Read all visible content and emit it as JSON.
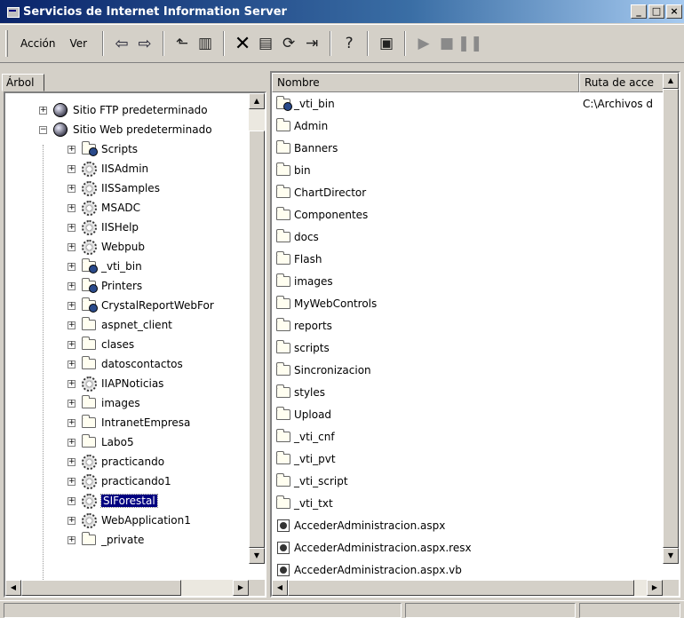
{
  "window": {
    "title": "Servicios de Internet Information Server",
    "controls": [
      "_",
      "□",
      "×"
    ]
  },
  "menu": {
    "action": "Acción",
    "view": "Ver"
  },
  "toolbar_icons": [
    "back-icon",
    "forward-icon",
    "up-folder-icon",
    "show-tree-icon",
    "delete-icon",
    "properties-icon",
    "refresh-icon",
    "export-icon",
    "help-icon",
    "computer-icon",
    "play-icon",
    "stop-icon",
    "pause-icon"
  ],
  "tree": {
    "tab_label": "Árbol",
    "items": [
      {
        "label": "Sitio FTP predeterminado",
        "icon": "ftp-site-icon",
        "expander": "+",
        "level": 0
      },
      {
        "label": "Sitio Web predeterminado",
        "icon": "web-site-icon",
        "expander": "−",
        "level": 0
      },
      {
        "label": "Scripts",
        "icon": "web-folder-icon",
        "expander": "+",
        "level": 1
      },
      {
        "label": "IISAdmin",
        "icon": "gear-icon",
        "expander": "+",
        "level": 1
      },
      {
        "label": "IISSamples",
        "icon": "gear-icon",
        "expander": "+",
        "level": 1
      },
      {
        "label": "MSADC",
        "icon": "gear-icon",
        "expander": "+",
        "level": 1
      },
      {
        "label": "IISHelp",
        "icon": "gear-icon",
        "expander": "+",
        "level": 1
      },
      {
        "label": "Webpub",
        "icon": "gear-icon",
        "expander": "+",
        "level": 1
      },
      {
        "label": "_vti_bin",
        "icon": "web-folder-icon",
        "expander": "+",
        "level": 1
      },
      {
        "label": "Printers",
        "icon": "web-folder-icon",
        "expander": "+",
        "level": 1
      },
      {
        "label": "CrystalReportWebFor",
        "icon": "web-folder-icon",
        "expander": "+",
        "level": 1
      },
      {
        "label": "aspnet_client",
        "icon": "folder-icon",
        "expander": "+",
        "level": 1
      },
      {
        "label": "clases",
        "icon": "folder-icon",
        "expander": "+",
        "level": 1
      },
      {
        "label": "datoscontactos",
        "icon": "folder-icon",
        "expander": "+",
        "level": 1
      },
      {
        "label": "IIAPNoticias",
        "icon": "gear-icon",
        "expander": "+",
        "level": 1
      },
      {
        "label": "images",
        "icon": "folder-icon",
        "expander": "+",
        "level": 1
      },
      {
        "label": "IntranetEmpresa",
        "icon": "folder-icon",
        "expander": "+",
        "level": 1
      },
      {
        "label": "Labo5",
        "icon": "folder-icon",
        "expander": "+",
        "level": 1
      },
      {
        "label": "practicando",
        "icon": "gear-icon",
        "expander": "+",
        "level": 1
      },
      {
        "label": "practicando1",
        "icon": "gear-icon",
        "expander": "+",
        "level": 1
      },
      {
        "label": "SIForestal",
        "icon": "gear-icon",
        "expander": "+",
        "level": 1,
        "selected": true
      },
      {
        "label": "WebApplication1",
        "icon": "gear-icon",
        "expander": "+",
        "level": 1
      },
      {
        "label": "_private",
        "icon": "folder-icon",
        "expander": "+",
        "level": 1
      }
    ]
  },
  "list": {
    "columns": [
      "Nombre",
      "Ruta de acce"
    ],
    "rows": [
      {
        "name": "_vti_bin",
        "icon": "web-folder-icon",
        "path": "C:\\Archivos d"
      },
      {
        "name": "Admin",
        "icon": "folder-icon",
        "path": ""
      },
      {
        "name": "Banners",
        "icon": "folder-icon",
        "path": ""
      },
      {
        "name": "bin",
        "icon": "folder-icon",
        "path": ""
      },
      {
        "name": "ChartDirector",
        "icon": "folder-icon",
        "path": ""
      },
      {
        "name": "Componentes",
        "icon": "folder-icon",
        "path": ""
      },
      {
        "name": "docs",
        "icon": "folder-icon",
        "path": ""
      },
      {
        "name": "Flash",
        "icon": "folder-icon",
        "path": ""
      },
      {
        "name": "images",
        "icon": "folder-icon",
        "path": ""
      },
      {
        "name": "MyWebControls",
        "icon": "folder-icon",
        "path": ""
      },
      {
        "name": "reports",
        "icon": "folder-icon",
        "path": ""
      },
      {
        "name": "scripts",
        "icon": "folder-icon",
        "path": ""
      },
      {
        "name": "Sincronizacion",
        "icon": "folder-icon",
        "path": ""
      },
      {
        "name": "styles",
        "icon": "folder-icon",
        "path": ""
      },
      {
        "name": "Upload",
        "icon": "folder-icon",
        "path": ""
      },
      {
        "name": "_vti_cnf",
        "icon": "folder-icon",
        "path": ""
      },
      {
        "name": "_vti_pvt",
        "icon": "folder-icon",
        "path": ""
      },
      {
        "name": "_vti_script",
        "icon": "folder-icon",
        "path": ""
      },
      {
        "name": "_vti_txt",
        "icon": "folder-icon",
        "path": ""
      },
      {
        "name": "AccederAdministracion.aspx",
        "icon": "aspx-file-icon",
        "path": ""
      },
      {
        "name": "AccederAdministracion.aspx.resx",
        "icon": "aspx-file-icon",
        "path": ""
      },
      {
        "name": "AccederAdministracion.aspx.vb",
        "icon": "aspx-file-icon",
        "path": ""
      }
    ]
  },
  "colors": {
    "title_start": "#0a246a",
    "title_end": "#a6caf0",
    "selection": "#000080",
    "chrome": "#d4d0c8"
  }
}
